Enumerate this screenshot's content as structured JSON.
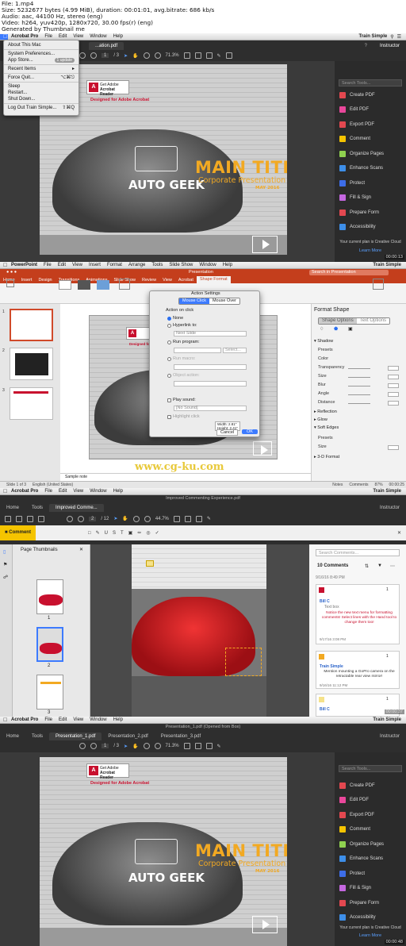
{
  "meta": {
    "lines": [
      "File: 1.mp4",
      "Size: 5232677 bytes (4.99 MiB), duration: 00:01:01, avg.bitrate: 686 kb/s",
      "Audio: aac, 44100 Hz, stereo (eng)",
      "Video: h264, yuv420p, 1280x720, 30.00 fps(r) (eng)",
      "Generated by Thumbnail me"
    ]
  },
  "colors": {
    "acrobat_red": "#c8102e",
    "title_orange": "#f2a922",
    "ppt_red": "#c43e1c",
    "accent_blue": "#2a6ff0"
  },
  "acrobat_menu": [
    "Acrobat Pro",
    "File",
    "Edit",
    "View",
    "Window",
    "Help"
  ],
  "train_simple": "Train Simple",
  "instructor": "Instructor",
  "panel1": {
    "tab": "...ation.pdf",
    "doc_title": "Presentation.pdf",
    "page": "1",
    "page_total": "/ 3",
    "zoom": "71.3%",
    "timestamp": "00:00:13",
    "apple_menu": {
      "items": [
        {
          "label": "About This Mac",
          "shortcut": ""
        },
        {
          "sep": true
        },
        {
          "label": "System Preferences...",
          "shortcut": ""
        },
        {
          "label": "App Store...",
          "shortcut": "",
          "badge": "1 update"
        },
        {
          "sep": true
        },
        {
          "label": "Recent Items",
          "shortcut": "▸"
        },
        {
          "sep": true
        },
        {
          "label": "Force Quit...",
          "shortcut": "⌥⌘⎋"
        },
        {
          "sep": true
        },
        {
          "label": "Sleep",
          "shortcut": ""
        },
        {
          "label": "Restart...",
          "shortcut": ""
        },
        {
          "label": "Shut Down...",
          "shortcut": ""
        },
        {
          "sep": true
        },
        {
          "label": "Log Out Train Simple...",
          "shortcut": "⇧⌘Q"
        }
      ]
    }
  },
  "slide": {
    "get_adobe": "Get Adobe",
    "acrobat_reader": "Acrobat Reader",
    "designed_for": "Designed for Adobe Acrobat",
    "main_title": "MAIN TITLE",
    "corporate": "Corporate Presentation",
    "date": "MAY 2016",
    "auto_geek": "AUTO GEEK"
  },
  "tools_pane": {
    "search": "Search Tools...",
    "items": [
      {
        "label": "Create PDF",
        "color": "#e34850"
      },
      {
        "label": "Edit PDF",
        "color": "#e9479b"
      },
      {
        "label": "Export PDF",
        "color": "#e34850"
      },
      {
        "label": "Comment",
        "color": "#f5c400"
      },
      {
        "label": "Organize Pages",
        "color": "#8fd14f"
      },
      {
        "label": "Enhance Scans",
        "color": "#3d8ee8"
      },
      {
        "label": "Protect",
        "color": "#3d6de8"
      },
      {
        "label": "Fill & Sign",
        "color": "#c567e0"
      },
      {
        "label": "Prepare Form",
        "color": "#e34850"
      },
      {
        "label": "Accessibility",
        "color": "#3d8ee8"
      }
    ],
    "plan": "Your current plan is Creative Cloud",
    "learn_more": "Learn More"
  },
  "panel2": {
    "menu": [
      "PowerPoint",
      "File",
      "Edit",
      "View",
      "Insert",
      "Format",
      "Arrange",
      "Tools",
      "Slide Show",
      "Window",
      "Help"
    ],
    "window_title": "Presentation",
    "search": "Search in Presentation",
    "tabs": [
      "Home",
      "Insert",
      "Design",
      "Transitions",
      "Animations",
      "Slide Show",
      "Review",
      "View",
      "Acrobat",
      "Shape Format"
    ],
    "dialog": {
      "title": "Action Settings",
      "seg": [
        "Mouse Click",
        "Mouse Over"
      ],
      "action_on_click": "Action on click",
      "none": "None",
      "hyperlink": "Hyperlink to:",
      "next_slide": "Next Slide",
      "run_program": "Run program:",
      "select": "Select...",
      "run_macro": "Run macro:",
      "object_action": "Object action:",
      "play_sound": "Play sound:",
      "no_sound": "[No Sound]",
      "highlight": "Highlight click",
      "cancel": "Cancel",
      "ok": "OK"
    },
    "tooltip": [
      "Width: 2.81\"",
      "Height: 2.41\""
    ],
    "format_shape": {
      "title": "Format Shape",
      "tabs": [
        "Shape Options",
        "Text Options"
      ],
      "shadow": "Shadow",
      "rows": [
        "Presets",
        "Color",
        "Transparency",
        "Size",
        "Blur",
        "Angle",
        "Distance"
      ],
      "reflection": "Reflection",
      "glow": "Glow",
      "soft_edges": "Soft Edges",
      "soft_rows": [
        "Presets",
        "Size"
      ],
      "format3d": "3-D Format"
    },
    "notes": "Sample note",
    "status": [
      "Slide 1 of 3",
      "English (United States)",
      "Notes",
      "Comments",
      "87%"
    ],
    "watermark": "www.cg-ku.com",
    "timestamp": "00:00:25"
  },
  "panel3": {
    "tabs": [
      "Home",
      "Tools",
      "Improved Comme..."
    ],
    "doc_title": "Improved Commenting Experience.pdf",
    "page": "2",
    "page_total": "/ 12",
    "zoom": "44.7%",
    "comment_label": "Comment",
    "thumb_title": "Page Thumbnails",
    "thumb_nums": [
      "1",
      "2",
      "3"
    ],
    "search_comments": "Search Comments...",
    "comments_count": "10 Comments",
    "comments": [
      {
        "meta": "9/16/16  8:49 PM",
        "count": "1"
      },
      {
        "name": "Bill C",
        "sub": "Text box",
        "body": "Notice the new text menu for formatting comments! Select lines with the Hand tool to change them too!",
        "meta": "9/17/16  3:08 PM"
      },
      {
        "name": "Train Simple",
        "body": "Mention mounting a GoPro camera on the retractable rear view mirror!",
        "meta": "9/16/16  11:12 PM",
        "count": "1"
      },
      {
        "name": "Bill C",
        "count": "1"
      }
    ],
    "timestamp": "00:00:37"
  },
  "panel4": {
    "window_title": "Presentation_1.pdf (Opened from Box)",
    "tabs": [
      "Home",
      "Tools",
      "Presentation_1.pdf",
      "Presentation_2.pdf",
      "Presentation_3.pdf"
    ],
    "page": "1",
    "page_total": "/ 3",
    "zoom": "71.3%",
    "timestamp": "00:00:48"
  }
}
